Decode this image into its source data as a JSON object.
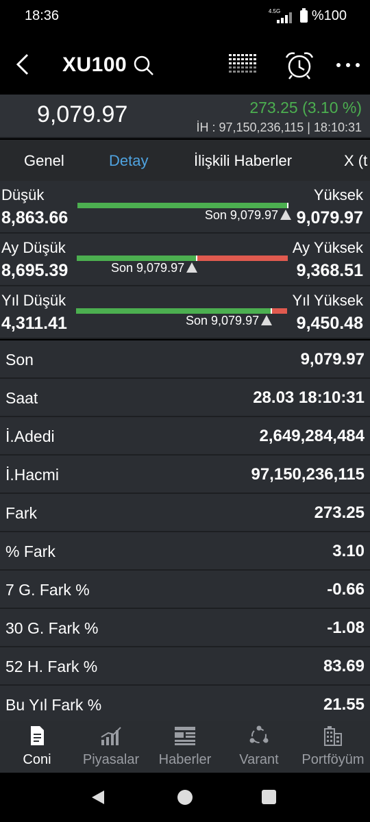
{
  "status_bar": {
    "time": "18:36",
    "network": "4.5G",
    "battery": "%100"
  },
  "header": {
    "title": "XU100"
  },
  "quote": {
    "price": "9,079.97",
    "change": "273.25 (3.10 %)",
    "meta": "İH : 97,150,236,115  |  18:10:31"
  },
  "tabs": [
    {
      "label": "Genel"
    },
    {
      "label": "Detay"
    },
    {
      "label": "İlişkili Haberler"
    },
    {
      "label": "X (t"
    }
  ],
  "ranges": [
    {
      "low_label": "Düşük",
      "low_value": "8,863.66",
      "high_label": "Yüksek",
      "high_value": "9,079.97",
      "marker_label": "Son 9,079.97",
      "position": 1.0
    },
    {
      "low_label": "Ay Düşük",
      "low_value": "8,695.39",
      "high_label": "Ay Yüksek",
      "high_value": "9,368.51",
      "marker_label": "Son 9,079.97",
      "position": 0.57
    },
    {
      "low_label": "Yıl Düşük",
      "low_value": "4,311.41",
      "high_label": "Yıl Yüksek",
      "high_value": "9,450.48",
      "marker_label": "Son 9,079.97",
      "position": 0.93
    }
  ],
  "details": [
    {
      "label": "Son",
      "value": "9,079.97"
    },
    {
      "label": "Saat",
      "value": "28.03 18:10:31"
    },
    {
      "label": "İ.Adedi",
      "value": "2,649,284,484"
    },
    {
      "label": "İ.Hacmi",
      "value": "97,150,236,115"
    },
    {
      "label": "Fark",
      "value": "273.25"
    },
    {
      "label": "% Fark",
      "value": "3.10"
    },
    {
      "label": "7 G. Fark %",
      "value": "-0.66"
    },
    {
      "label": "30 G. Fark %",
      "value": "-1.08"
    },
    {
      "label": "52 H. Fark %",
      "value": "83.69"
    },
    {
      "label": "Bu Yıl Fark %",
      "value": "21.55"
    }
  ],
  "bottom_nav": [
    {
      "label": "Coni",
      "icon": "document-icon"
    },
    {
      "label": "Piyasalar",
      "icon": "chart-bars-icon"
    },
    {
      "label": "Haberler",
      "icon": "news-icon"
    },
    {
      "label": "Varant",
      "icon": "share-icon"
    },
    {
      "label": "Portföyüm",
      "icon": "building-icon"
    }
  ],
  "colors": {
    "up": "#4caf50",
    "down": "#e05a4f",
    "accent": "#4fa3e0"
  }
}
